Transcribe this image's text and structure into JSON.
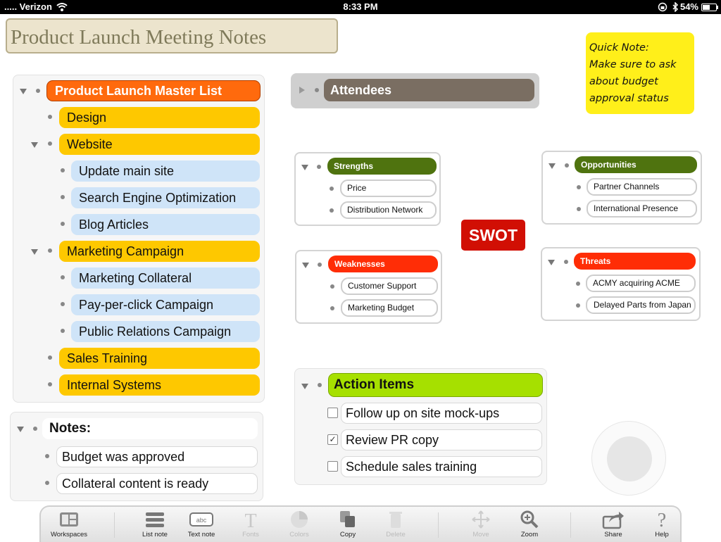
{
  "status_bar": {
    "carrier": "..... Verizon",
    "time": "8:33 PM",
    "battery": "54%"
  },
  "title": "Product Launch Meeting Notes",
  "quick_note": {
    "lines": [
      "Quick Note:",
      "Make sure to ask",
      "about budget",
      "approval status"
    ]
  },
  "master_list": {
    "heading": "Product Launch Master List",
    "items": [
      "Design",
      "Website",
      "Update main site",
      "Search Engine Optimization",
      "Blog Articles",
      "Marketing Campaign",
      "Marketing Collateral",
      "Pay-per-click Campaign",
      "Public Relations Campaign",
      "Sales Training",
      "Internal Systems"
    ]
  },
  "notes": {
    "heading": "Notes:",
    "items": [
      "Budget was approved",
      "Collateral content is ready"
    ]
  },
  "attendees": {
    "label": "Attendees"
  },
  "swot": {
    "label": "SWOT",
    "strengths": {
      "heading": "Strengths",
      "items": [
        "Price",
        "Distribution Network"
      ]
    },
    "weaknesses": {
      "heading": "Weaknesses",
      "items": [
        "Customer Support",
        "Marketing Budget"
      ]
    },
    "opportunities": {
      "heading": "Opportunities",
      "items": [
        "Partner Channels",
        "International Presence"
      ]
    },
    "threats": {
      "heading": "Threats",
      "items": [
        "ACMY acquiring ACME",
        "Delayed Parts from Japan"
      ]
    }
  },
  "action_items": {
    "heading": "Action Items",
    "items": [
      {
        "label": "Follow up on site mock-ups",
        "checked": false
      },
      {
        "label": "Review PR copy",
        "checked": true
      },
      {
        "label": "Schedule sales training",
        "checked": false
      }
    ]
  },
  "toolbar": {
    "workspaces": "Workspaces",
    "list_note": "List note",
    "text_note": "Text note",
    "text_note_icon_text": "abc",
    "fonts": "Fonts",
    "colors": "Colors",
    "copy": "Copy",
    "delete": "Delete",
    "move": "Move",
    "zoom": "Zoom",
    "share": "Share",
    "help": "Help"
  },
  "colors": {
    "accent_orange": "#ff6a0d",
    "item_yellow": "#fec800",
    "item_blue": "#cfe4f8",
    "swot_green": "#4f730f",
    "swot_red": "#ff2d06",
    "action_green": "#a6e000",
    "quick_note_yellow": "#ffef1a",
    "swot_label_red": "#d10f04"
  }
}
